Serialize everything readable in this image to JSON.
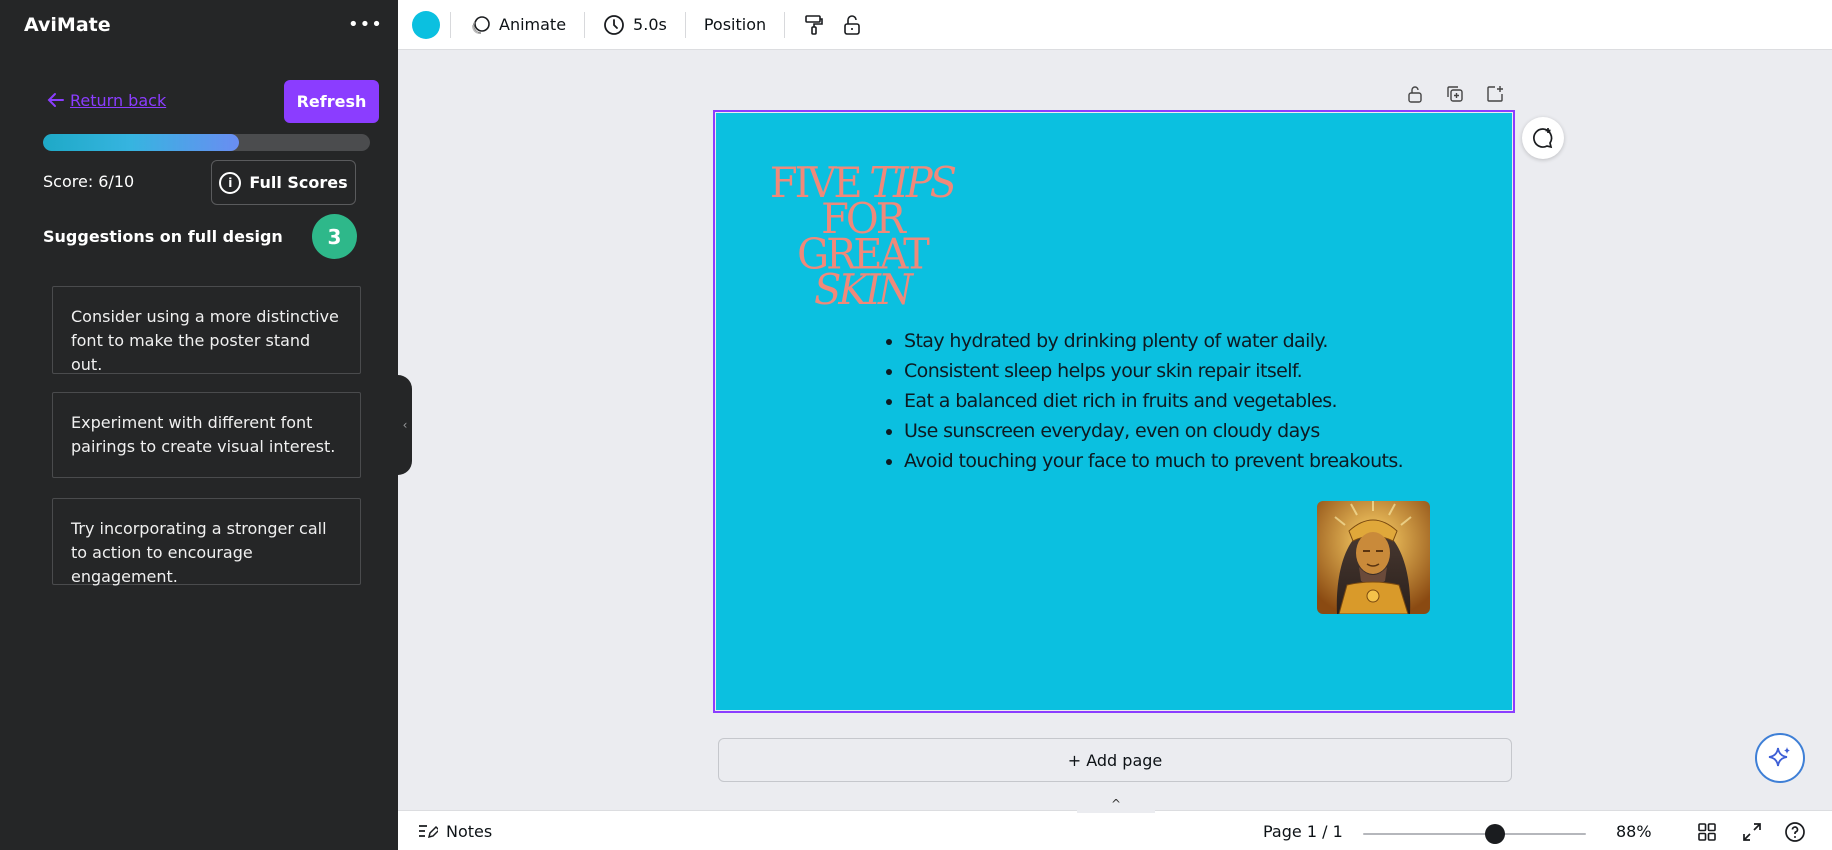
{
  "sidebar": {
    "title": "AviMate",
    "more": "•••",
    "return_label": "Return back",
    "refresh_label": "Refresh",
    "progress_fraction": 0.6,
    "score_text": "Score: 6/10",
    "full_scores_label": "Full Scores",
    "suggestions_title": "Suggestions on full design",
    "suggestions_count": "3",
    "suggestions": [
      "Consider using a more distinctive font to make the poster stand out.",
      "Experiment with different font pairings to create visual interest.",
      "Try incorporating a stronger call to action to encourage engagement."
    ]
  },
  "toolbar": {
    "color": "#0bc0e0",
    "animate_label": "Animate",
    "duration_label": "5.0s",
    "position_label": "Position"
  },
  "slide": {
    "background": "#0bc0e0",
    "title_line1_a": "FIVE ",
    "title_line1_b": "TIPS",
    "title_line2": "FOR GREAT",
    "title_line3": "SKIN",
    "bullets": [
      "Stay hydrated by drinking plenty of water daily.",
      "Consistent sleep helps your skin repair itself.",
      "Eat a balanced diet rich in fruits and vegetables.",
      "Use sunscreen everyday, even on cloudy days",
      "Avoid touching your face to much to prevent breakouts."
    ]
  },
  "add_page_label": "+ Add page",
  "bottom": {
    "notes_label": "Notes",
    "page_indicator": "Page 1 / 1",
    "zoom_label": "88%",
    "zoom_fraction": 0.59
  }
}
